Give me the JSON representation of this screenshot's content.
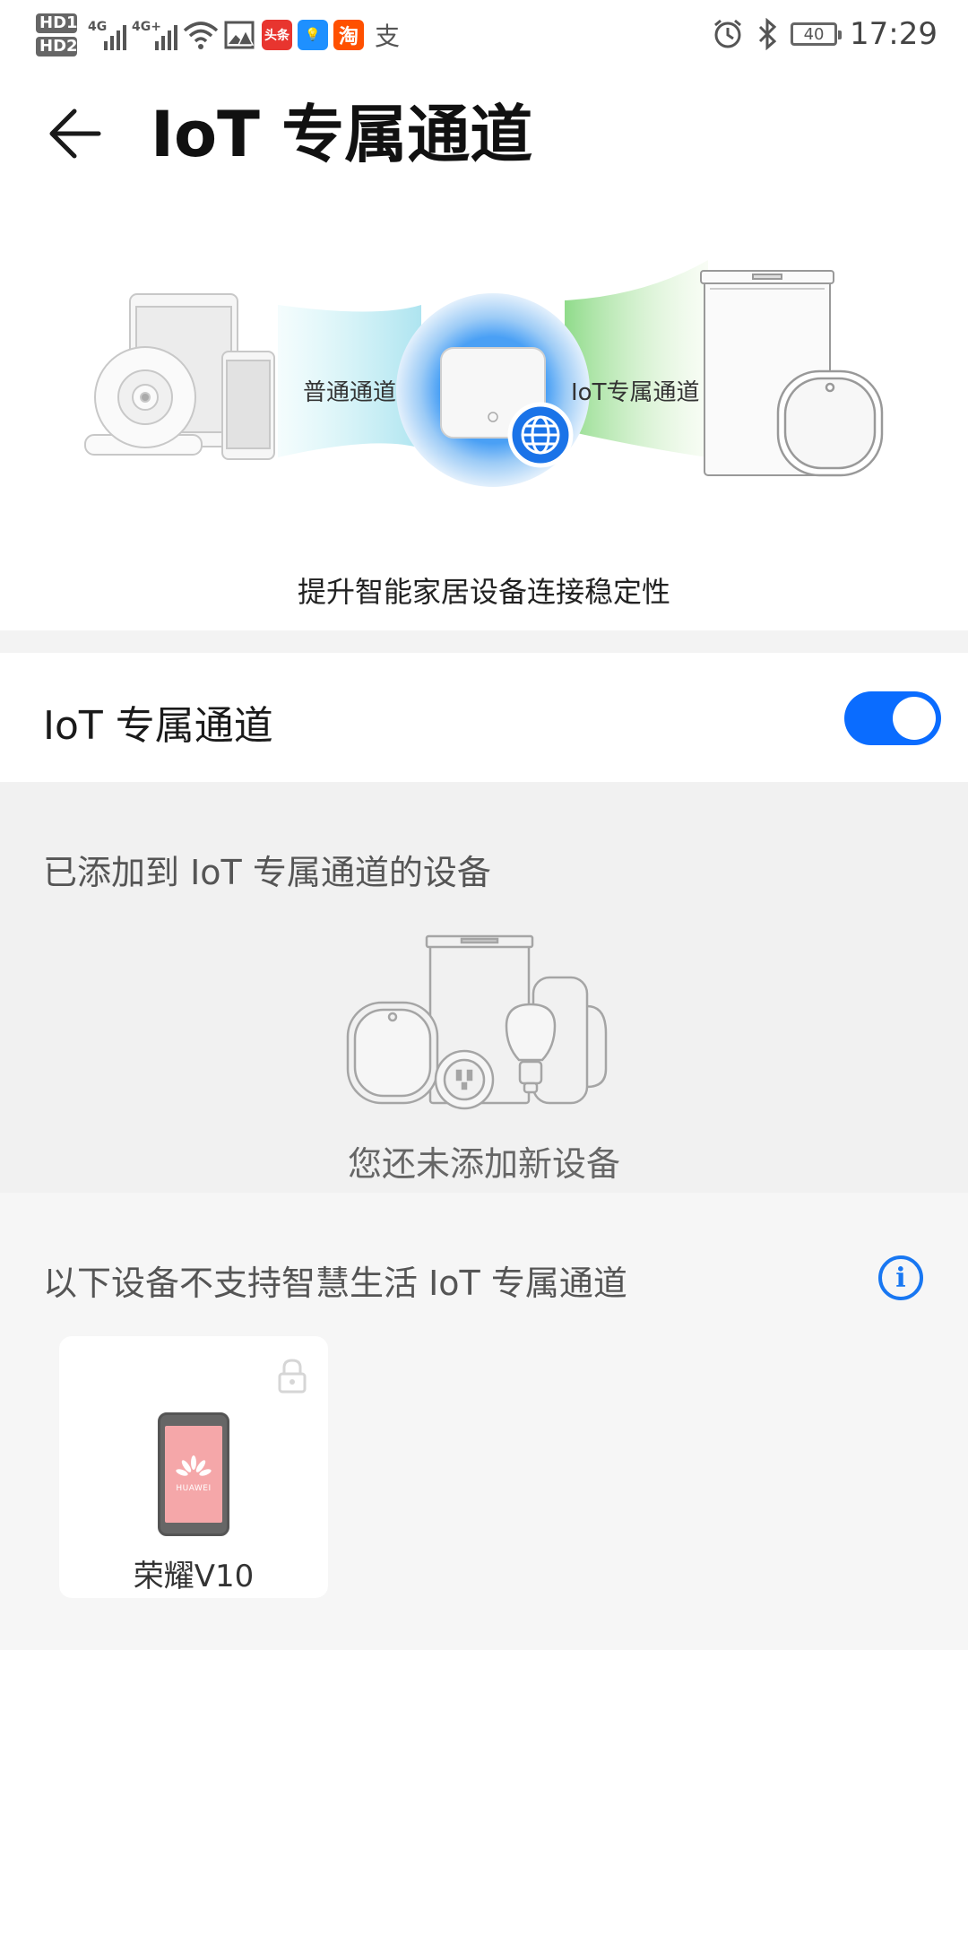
{
  "status_bar": {
    "sim1": "HD",
    "sim1_index": "1",
    "sim2": "HD",
    "sim2_index": "2",
    "net1": "4G",
    "net2": "4G+",
    "apps": [
      {
        "name": "toutiao-app-icon",
        "label": "头条",
        "color": "#e8352f"
      },
      {
        "name": "bulb-app-icon",
        "label": "💡",
        "color": "#1e90ff"
      },
      {
        "name": "taobao-app-icon",
        "label": "淘",
        "color": "#ff5000"
      }
    ],
    "alipay_glyph": "支",
    "battery": "40",
    "time": "17:29"
  },
  "header": {
    "title": "IoT 专属通道"
  },
  "hero": {
    "left_channel": "普通通道",
    "right_channel": "IoT专属通道",
    "tagline": "提升智能家居设备连接稳定性"
  },
  "toggle": {
    "label": "IoT 专属通道",
    "enabled": true,
    "color": "#0a6cff"
  },
  "added_section": {
    "title": "已添加到 IoT 专属通道的设备",
    "empty_text": "您还未添加新设备"
  },
  "unsupported_section": {
    "title": "以下设备不支持智慧生活 IoT 专属通道",
    "info_icon": "i",
    "devices": [
      {
        "name": "荣耀V10",
        "brand": "HUAWEI",
        "locked": true
      }
    ]
  }
}
